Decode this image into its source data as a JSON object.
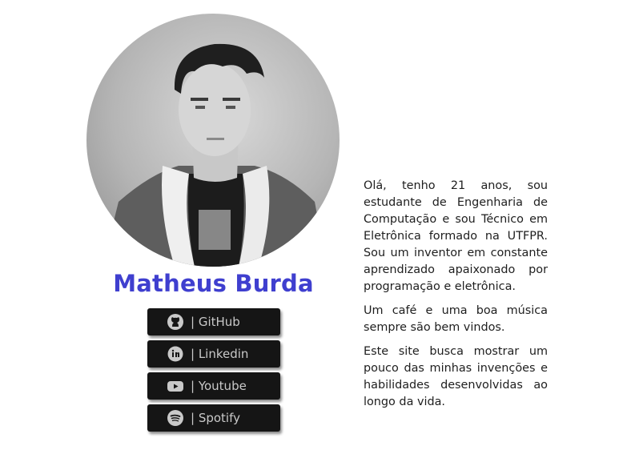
{
  "profile": {
    "name": "Matheus Burda",
    "name_color": "#3f3fcf",
    "photo_icon": "profile-photo"
  },
  "links": [
    {
      "label": "| GitHub",
      "icon": "github-icon"
    },
    {
      "label": "| Linkedin",
      "icon": "linkedin-icon"
    },
    {
      "label": "| Youtube",
      "icon": "youtube-icon"
    },
    {
      "label": "| Spotify",
      "icon": "spotify-icon"
    }
  ],
  "bio": {
    "paragraph_1": "Olá, tenho 21 anos, sou estudante de Engenharia de Computação e sou Técnico em Eletrônica formado na UTFPR. Sou um inventor em constante aprendizado apaixonado por programação e eletrônica.",
    "paragraph_2": "Um café e uma boa música sempre são bem vindos.",
    "paragraph_3": "Este site busca mostrar um pouco das minhas invenções e habilidades desenvolvidas ao longo da vida."
  }
}
